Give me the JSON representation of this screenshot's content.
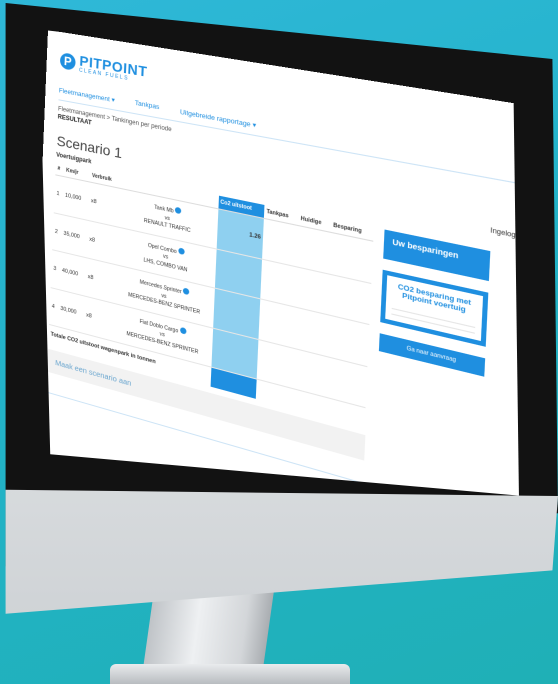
{
  "app": {
    "logo_text": "PITPOINT",
    "logo_sub": "CLEAN FUELS",
    "logo_mark": "P"
  },
  "nav": [
    "Fleetmanagement ▾",
    "Tankpas",
    "Uitgebreide rapportage ▾"
  ],
  "breadcrumb": "Fleetmanagement > Tankingen per periode",
  "section": "RESULTAAT",
  "scenario_title": "Scenario 1",
  "user_label": "Ingelogd ▾",
  "sub_label": "Voertuigpark",
  "table": {
    "headers": [
      "#",
      "Km/jr",
      "Verbruik",
      "",
      "Co2 uitstoot",
      "Tankpas",
      "Huidige",
      "Besparing"
    ],
    "rows": [
      {
        "n": "1",
        "km": "10,000",
        "unit": "x8",
        "v1": "Tank Mb",
        "vs": "vs",
        "v2": "RENAULT TRAFFIC",
        "co2": "1.26",
        "a": "",
        "b": "",
        "c": ""
      },
      {
        "n": "2",
        "km": "35,000",
        "unit": "x8",
        "v1": "Opel Combo",
        "vs": "vs",
        "v2": "LHS, COMBO VAN",
        "co2": "",
        "a": "",
        "b": "",
        "c": ""
      },
      {
        "n": "3",
        "km": "40,000",
        "unit": "x8",
        "v1": "Mercedes Sprinter",
        "vs": "vs",
        "v2": "MERCEDES-BENZ SPRINTER",
        "co2": "",
        "a": "",
        "b": "",
        "c": ""
      },
      {
        "n": "4",
        "km": "30,000",
        "unit": "x8",
        "v1": "Fiat Doblo Cargo",
        "vs": "vs",
        "v2": "MERCEDES-BENZ SPRINTER",
        "co2": "",
        "a": "",
        "b": "",
        "c": ""
      }
    ],
    "total_label": "Totale CO2 uitstoot wagenpark in tonnen",
    "total_co2": ""
  },
  "add_scenario": "Maak een scenario aan",
  "side_info": {
    "title": "Uw besparingen",
    "body": ""
  },
  "side_compare": {
    "title": "CO2 besparing met Pitpoint voertuig",
    "headers": [
      "",
      "",
      ""
    ],
    "values": [
      "",
      "",
      ""
    ]
  },
  "cta_label": "Ga naar aanvraag"
}
